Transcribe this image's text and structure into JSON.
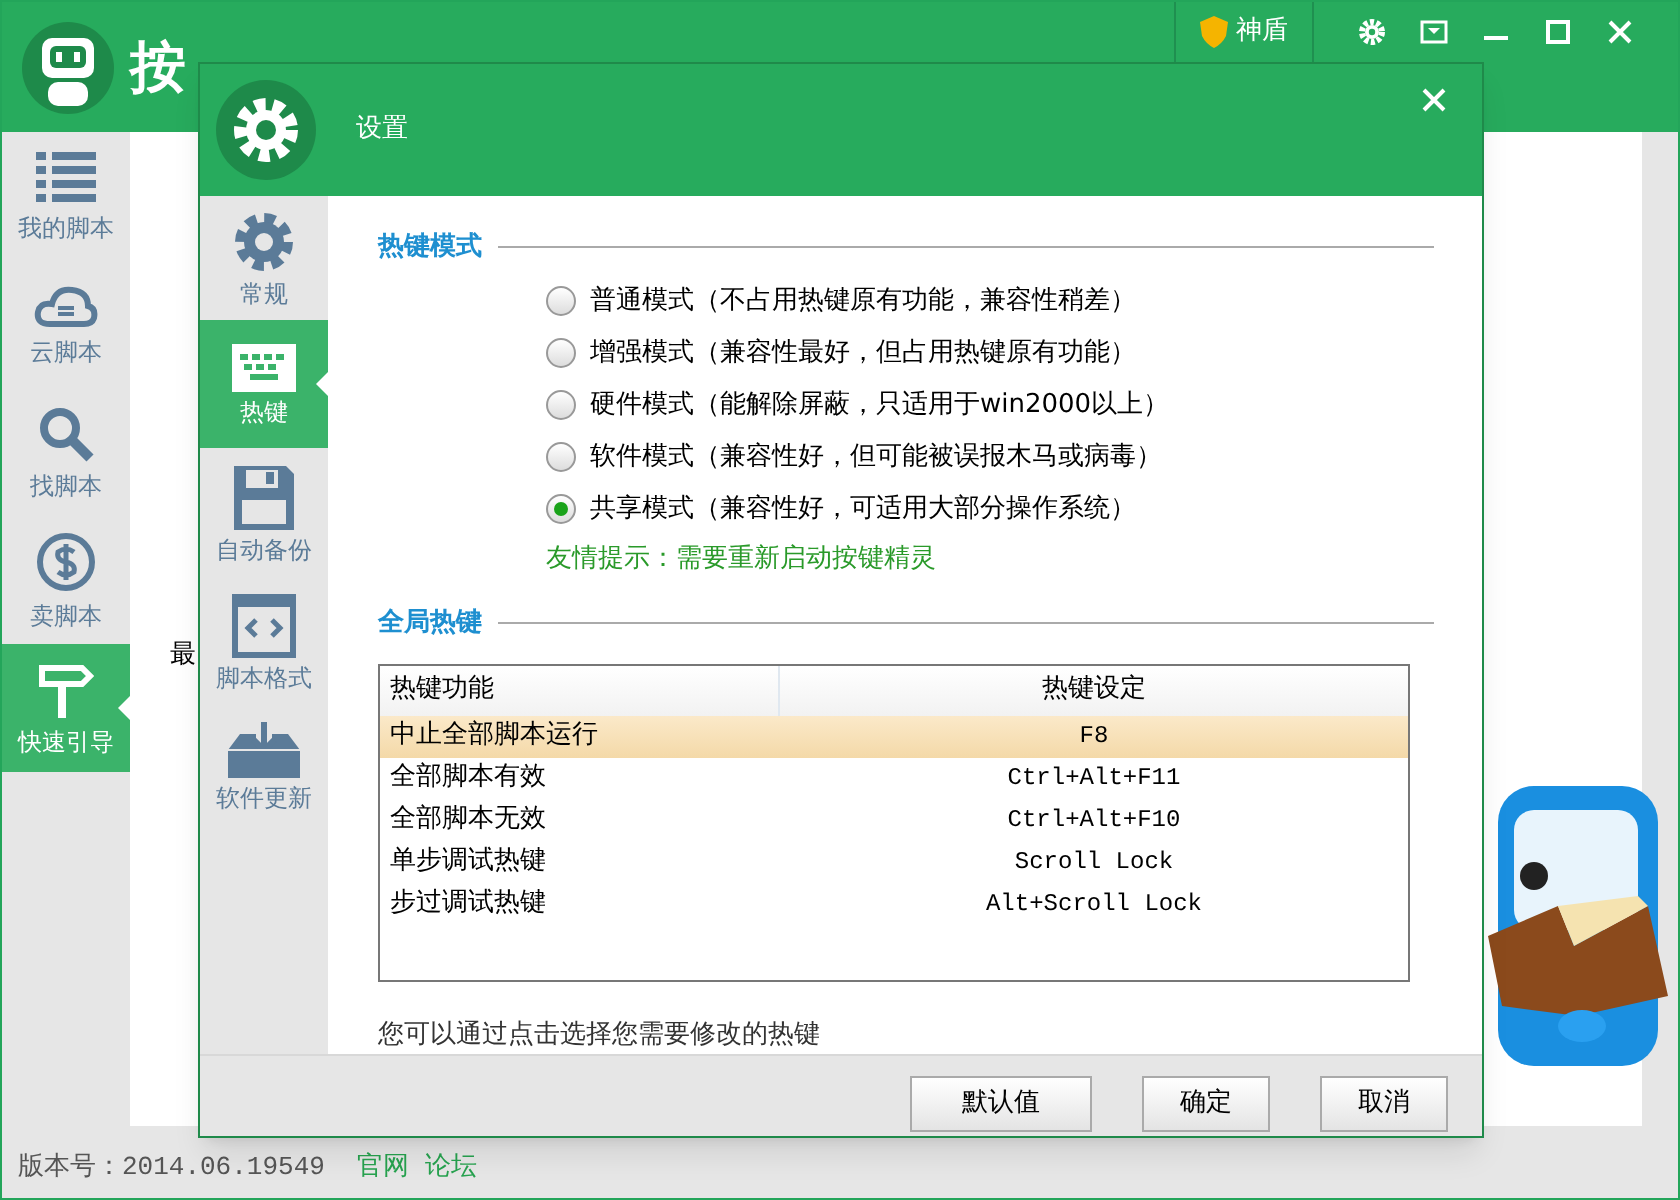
{
  "app": {
    "title": "按",
    "shield_label": "神盾"
  },
  "sidebar": {
    "items": [
      {
        "label": "我的脚本",
        "selected": false
      },
      {
        "label": "云脚本",
        "selected": false
      },
      {
        "label": "找脚本",
        "selected": false
      },
      {
        "label": "卖脚本",
        "selected": false
      },
      {
        "label": "快速引导",
        "selected": true
      }
    ]
  },
  "background": {
    "label": "最"
  },
  "status_bar": {
    "version": "版本号：2014.06.19549",
    "links": [
      "官网",
      "论坛"
    ]
  },
  "dialog": {
    "title": "设置",
    "nav": [
      {
        "label": "常规",
        "selected": false
      },
      {
        "label": "热键",
        "selected": true
      },
      {
        "label": "自动备份",
        "selected": false
      },
      {
        "label": "脚本格式",
        "selected": false
      },
      {
        "label": "软件更新",
        "selected": false
      }
    ],
    "hotkey_mode": {
      "title": "热键模式",
      "options": [
        {
          "label": "普通模式（不占用热键原有功能，兼容性稍差）",
          "selected": false
        },
        {
          "label": "增强模式（兼容性最好，但占用热键原有功能）",
          "selected": false
        },
        {
          "label": "硬件模式（能解除屏蔽，只适用于win2000以上）",
          "selected": false
        },
        {
          "label": "软件模式（兼容性好，但可能被误报木马或病毒）",
          "selected": false
        },
        {
          "label": "共享模式（兼容性好，可适用大部分操作系统）",
          "selected": true
        }
      ],
      "hint": "友情提示：需要重新启动按键精灵"
    },
    "global_hotkeys": {
      "title": "全局热键",
      "columns": [
        "热键功能",
        "热键设定"
      ],
      "rows": [
        {
          "cells": [
            "中止全部脚本运行",
            "F8"
          ],
          "selected": true
        },
        {
          "cells": [
            "全部脚本有效",
            "Ctrl+Alt+F11"
          ],
          "selected": false
        },
        {
          "cells": [
            "全部脚本无效",
            "Ctrl+Alt+F10"
          ],
          "selected": false
        },
        {
          "cells": [
            "单步调试热键",
            "Scroll Lock"
          ],
          "selected": false
        },
        {
          "cells": [
            "步过调试热键",
            "Alt+Scroll Lock"
          ],
          "selected": false
        }
      ]
    },
    "note": "您可以通过点击选择您需要修改的热键",
    "buttons": [
      "默认值",
      "确定",
      "取消"
    ]
  }
}
